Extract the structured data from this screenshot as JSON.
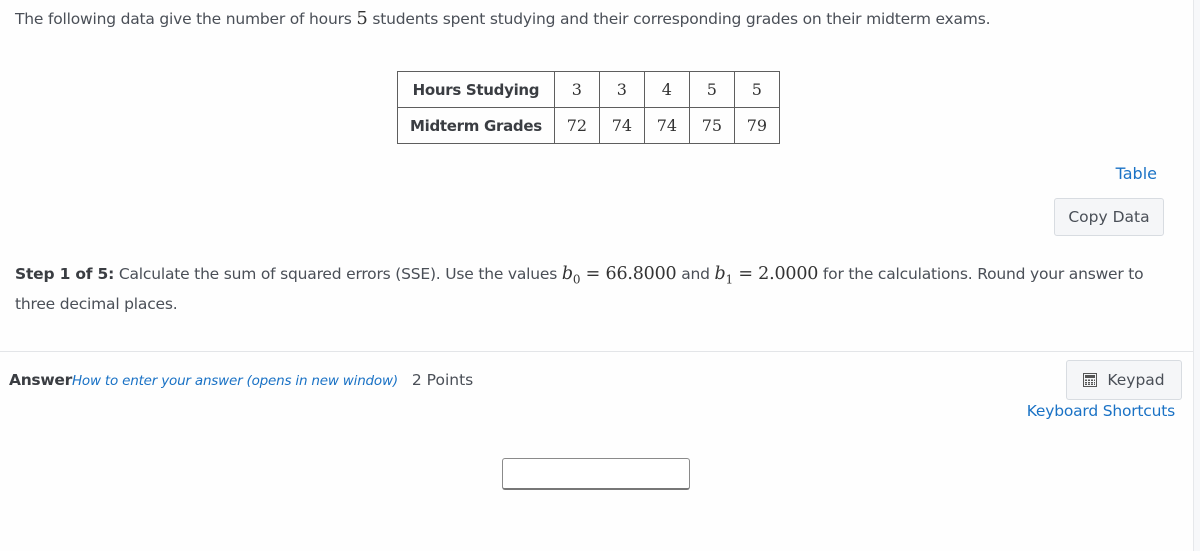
{
  "problem": {
    "intro_before": "The following data give the number of hours ",
    "intro_number": "5",
    "intro_after": " students spent studying and their corresponding grades on their midterm exams."
  },
  "table": {
    "rows": [
      {
        "header": "Hours Studying",
        "values": [
          "3",
          "3",
          "4",
          "5",
          "5"
        ]
      },
      {
        "header": "Midterm Grades",
        "values": [
          "72",
          "74",
          "74",
          "75",
          "79"
        ]
      }
    ],
    "view_link": "Table",
    "copy_button": "Copy Data"
  },
  "step": {
    "label": "Step 1 of 5:",
    "text_before": " Calculate the sum of squared errors (SSE). Use the values ",
    "b0_symbol": "b",
    "b0_sub": "0",
    "eq": " = ",
    "b0_value": "66.8000",
    "and_text": " and ",
    "b1_symbol": "b",
    "b1_sub": "1",
    "b1_value": "2.0000",
    "text_after": " for the calculations. Round your answer to three decimal places."
  },
  "answer": {
    "label": "Answer",
    "how_link": "How to enter your answer (opens in new window)",
    "points": "2 Points",
    "keypad_button": "Keypad",
    "keypad_icon": "calculator-icon",
    "shortcuts_link": "Keyboard Shortcuts",
    "input_value": "",
    "input_placeholder": ""
  },
  "colors": {
    "link": "#1a72c5",
    "text": "#4a4f57",
    "button_bg": "#f5f6f8",
    "button_border": "#d8dce1"
  }
}
